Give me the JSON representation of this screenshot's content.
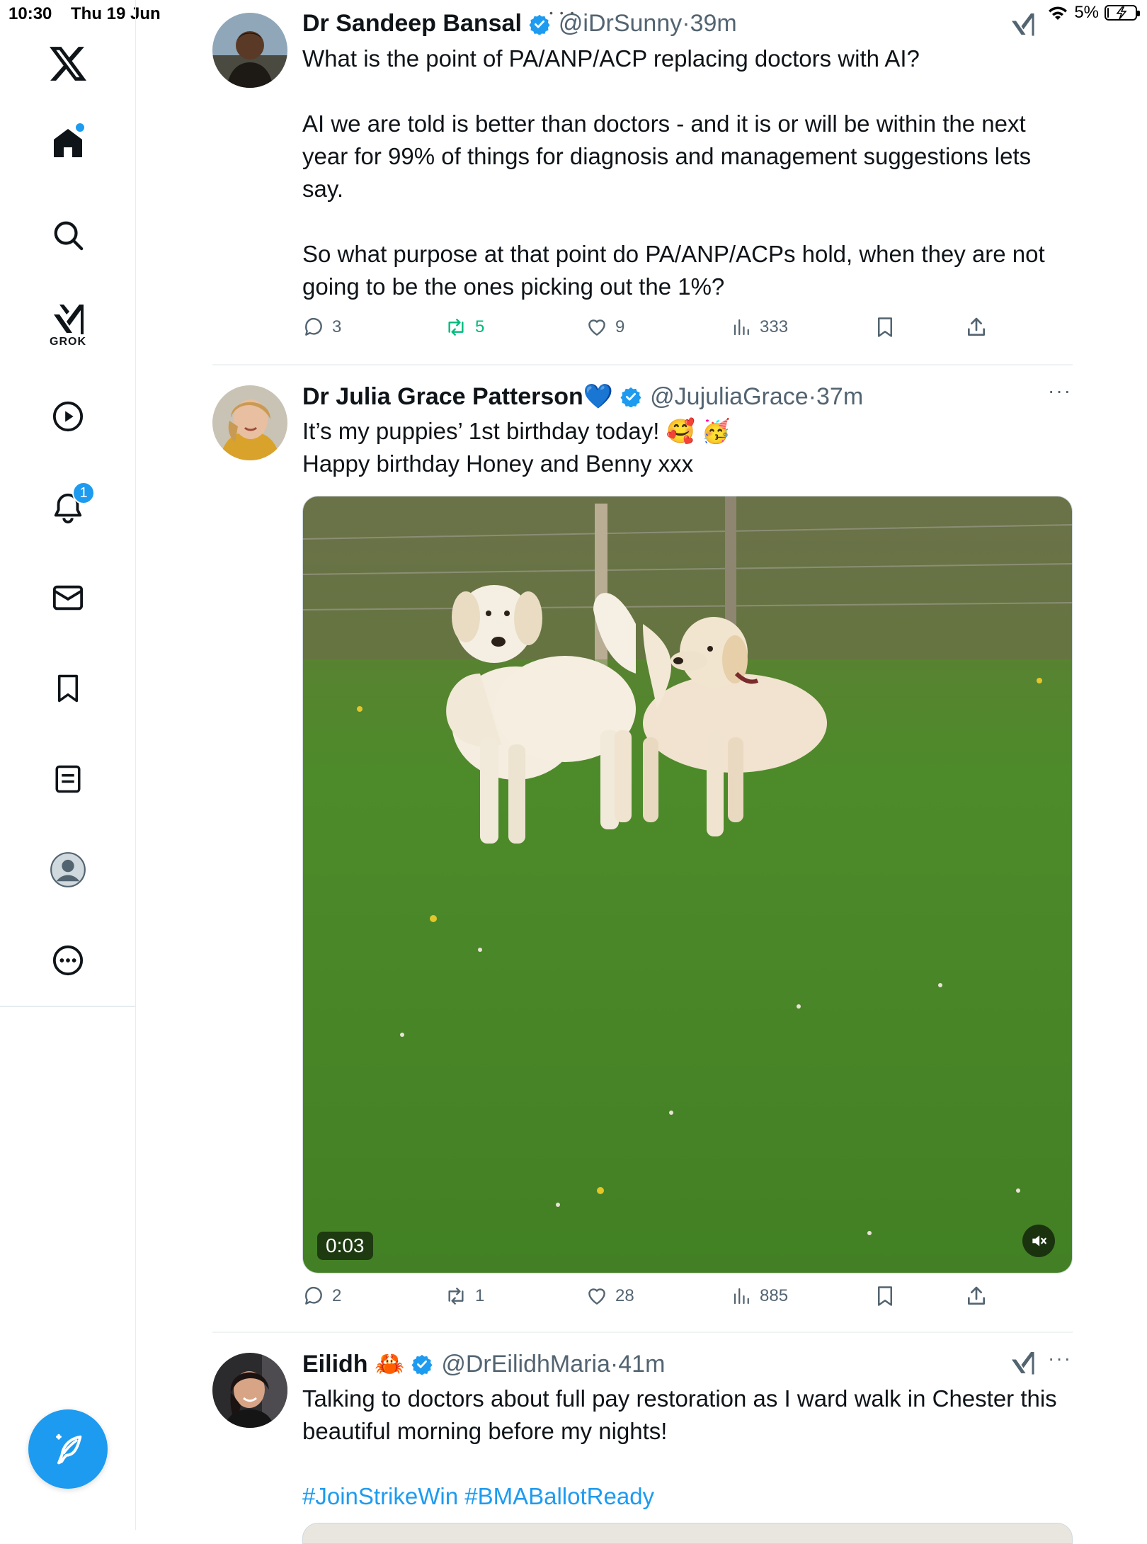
{
  "status_bar": {
    "time": "10:30",
    "date": "Thu 19 Jun",
    "battery": "5%",
    "battery_level": 0.05
  },
  "sidebar": {
    "grok_label": "GROK",
    "notifications_count": "1",
    "accent_color": "#1d9bf0"
  },
  "tweets": [
    {
      "name": "Dr Sandeep Bansal",
      "handle": "@iDrSunny",
      "sep": "·",
      "ago": "39m",
      "text": "What is the point of PA/ANP/ACP replacing doctors with AI?\n\nAI we are told is better than doctors - and it is or will be within the next year for 99% of things for diagnosis and management suggestions lets say.\n\nSo what purpose at that point do PA/ANP/ACPs hold, when they are not going to be the ones picking out the 1%?",
      "replies": "3",
      "reposts": "5",
      "likes": "9",
      "views": "333"
    },
    {
      "name": "Dr Julia Grace Patterson💙",
      "handle": "@JujuliaGrace",
      "sep": "·",
      "ago": "37m",
      "text": "It’s my puppies’ 1st birthday today! 🥰 🥳\nHappy birthday Honey and Benny xxx",
      "video_duration": "0:03",
      "replies": "2",
      "reposts": "1",
      "likes": "28",
      "views": "885"
    },
    {
      "name": "Eilidh 🦀",
      "handle": "@DrEilidhMaria",
      "sep": "·",
      "ago": "41m",
      "text": "Talking to doctors about full pay restoration as I ward walk in Chester this beautiful morning before my nights!",
      "hashtags": "#JoinStrikeWin #BMABallotReady"
    }
  ]
}
